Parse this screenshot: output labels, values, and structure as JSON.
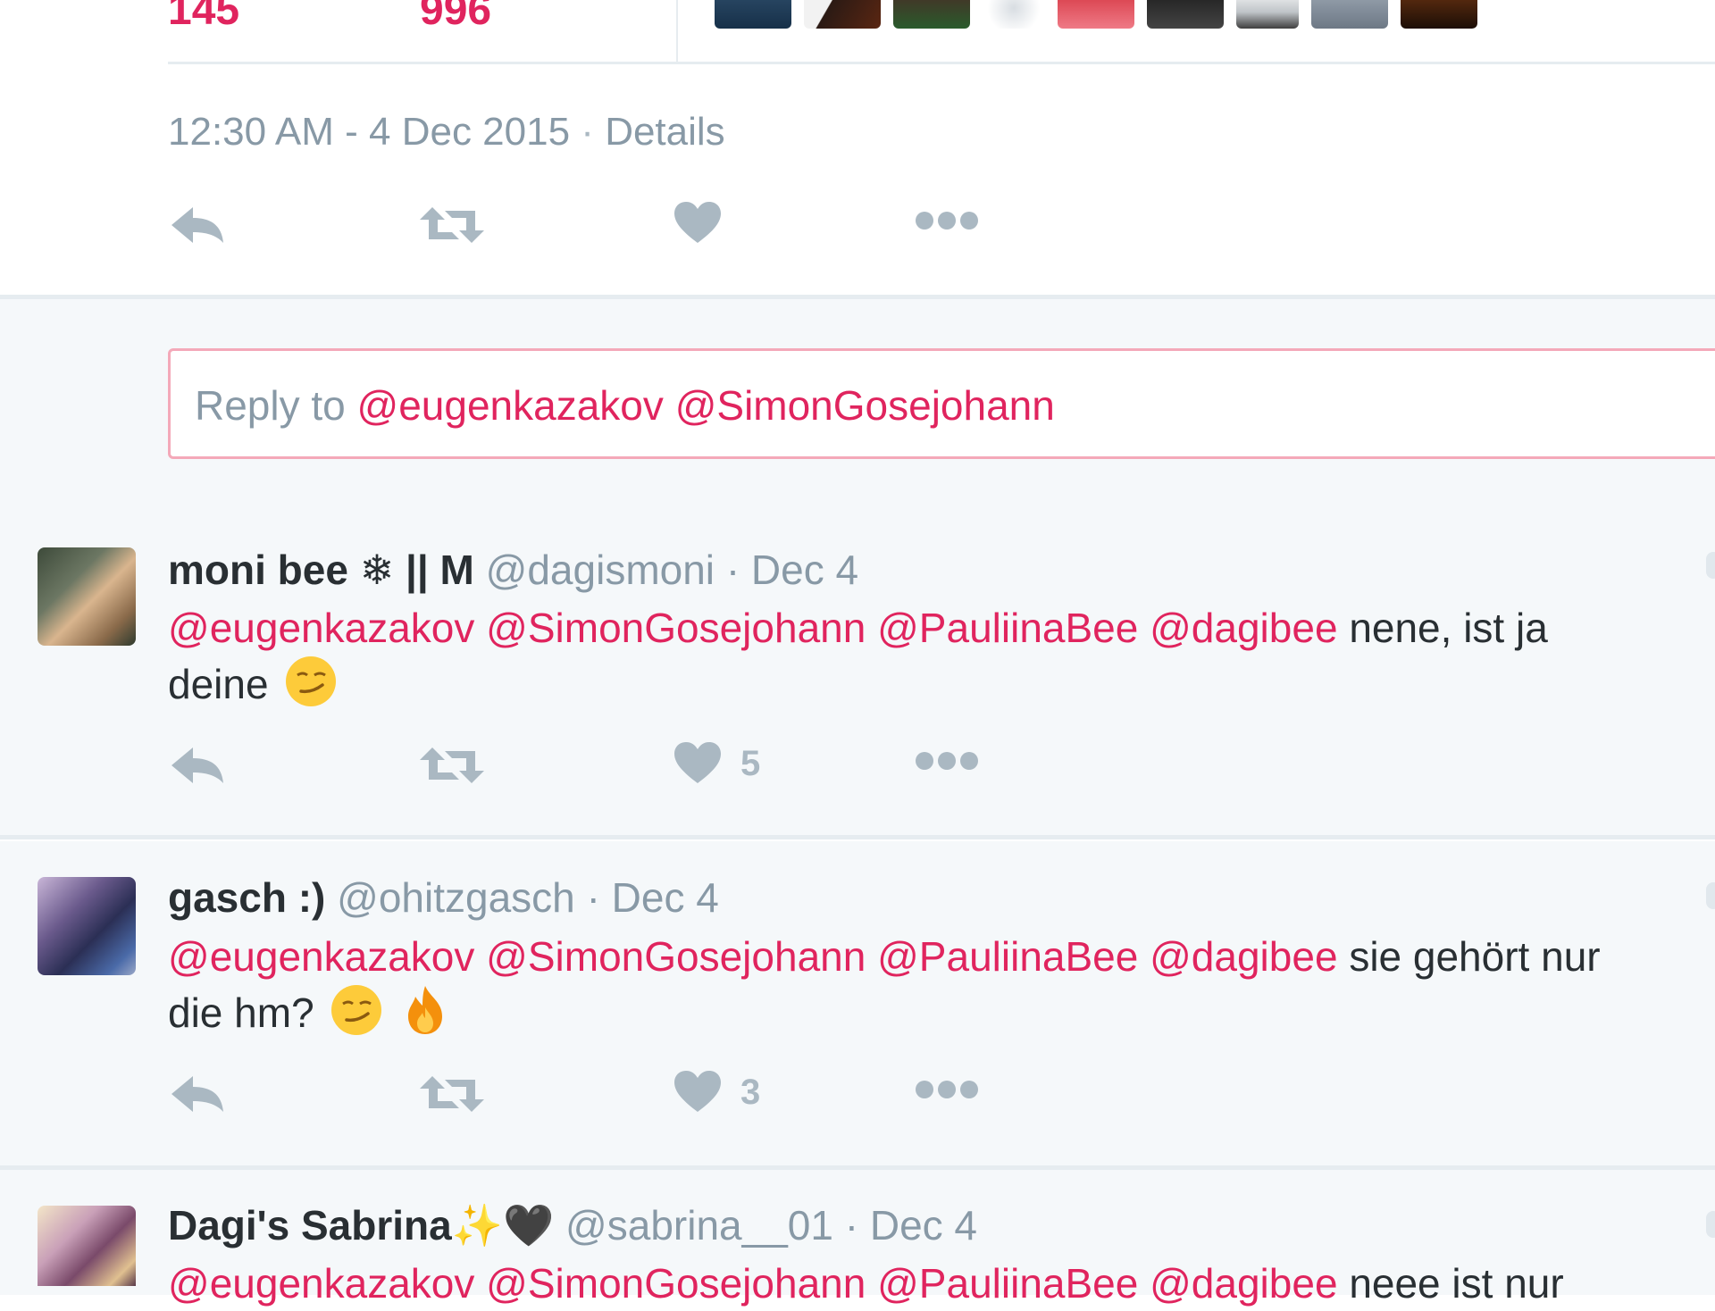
{
  "stats": {
    "retweets_value": "145",
    "likes_value": "996"
  },
  "timestamp": {
    "time": "12:30 AM - 4 Dec 2015",
    "separator": "·",
    "details_label": "Details"
  },
  "reply_box": {
    "prefix": "Reply to",
    "mentions": [
      "@eugenkazakov",
      "@SimonGosejohann"
    ]
  },
  "tweets": [
    {
      "name": "moni bee ❄ || M",
      "handle": "@dagismoni",
      "separator": "·",
      "date": "Dec 4",
      "mentions": [
        "@eugenkazakov",
        "@SimonGosejohann",
        "@PauliinaBee",
        "@dagibee"
      ],
      "text_line1": "nene, ist ja",
      "text_line2": "deine",
      "like_count": "5"
    },
    {
      "name": "gasch :)",
      "handle": "@ohitzgasch",
      "separator": "·",
      "date": "Dec 4",
      "mentions": [
        "@eugenkazakov",
        "@SimonGosejohann",
        "@PauliinaBee",
        "@dagibee"
      ],
      "text_line1": "sie gehört nur",
      "text_line2": "die hm?",
      "like_count": "3"
    },
    {
      "name": "Dagi's Sabrina✨🖤",
      "handle": "@sabrina__01",
      "separator": "·",
      "date": "Dec 4",
      "mentions": [
        "@eugenkazakov",
        "@SimonGosejohann",
        "@PauliinaBee",
        "@dagibee"
      ],
      "text_line1": "neee ist nur"
    }
  ],
  "icons": {
    "reply": "reply-icon",
    "retweet": "retweet-icon",
    "like": "heart-icon",
    "more": "more-dots-icon"
  },
  "colors": {
    "accent": "#e0245e",
    "muted": "#8899a6",
    "icon": "#aab8c2",
    "background": "#f5f8fa"
  }
}
